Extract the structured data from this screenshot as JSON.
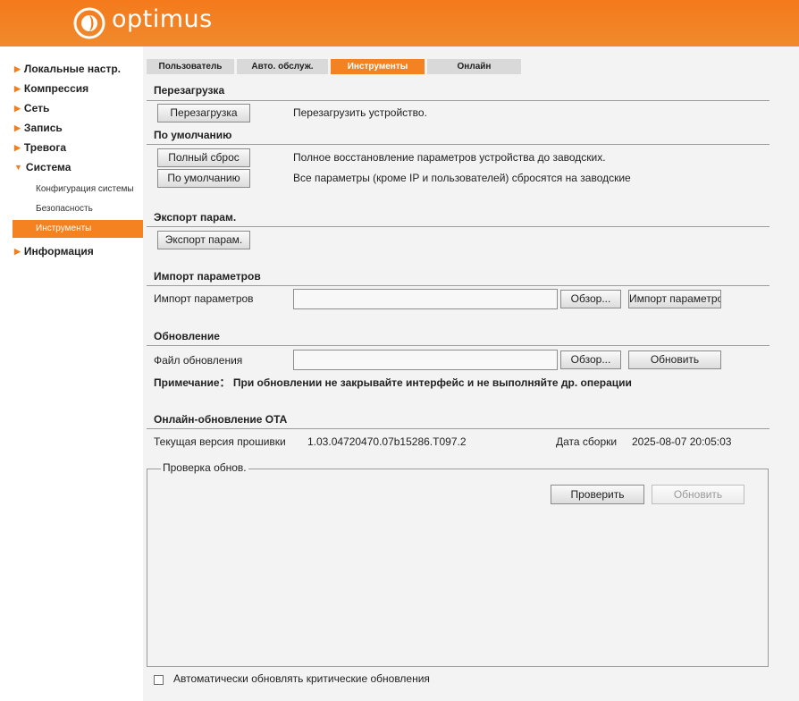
{
  "brand": {
    "name": "optimus"
  },
  "colors": {
    "accent": "#f58220",
    "topbar": "#f47a1c",
    "content_bg": "#f3f3f3"
  },
  "sidebar": {
    "items": [
      {
        "label": "Локальные настр.",
        "icon": "arrow-right"
      },
      {
        "label": "Компрессия",
        "icon": "arrow-right"
      },
      {
        "label": "Сеть",
        "icon": "arrow-right"
      },
      {
        "label": "Запись",
        "icon": "arrow-right"
      },
      {
        "label": "Тревога",
        "icon": "arrow-right"
      },
      {
        "label": "Система",
        "icon": "arrow-down",
        "children": [
          {
            "label": "Конфигурация системы"
          },
          {
            "label": "Безопасность"
          },
          {
            "label": "Инструменты",
            "active": true
          }
        ]
      },
      {
        "label": "Информация",
        "icon": "arrow-right"
      }
    ]
  },
  "tabs": [
    {
      "label": "Пользователь"
    },
    {
      "label": "Авто. обслуж."
    },
    {
      "label": "Инструменты",
      "active": true
    },
    {
      "label": "Онлайн"
    }
  ],
  "reboot": {
    "title": "Перезагрузка",
    "button": "Перезагрузка",
    "desc": "Перезагрузить устройство."
  },
  "defaults": {
    "title": "По умолчанию",
    "full_reset_button": "Полный сброс",
    "full_reset_desc": "Полное восстановление параметров устройства до заводских.",
    "default_button": "По умолчанию",
    "default_desc": "Все параметры (кроме IP и пользователей) сбросятся на заводские"
  },
  "export": {
    "title": "Экспорт парам.",
    "button": "Экспорт парам."
  },
  "import": {
    "title": "Импорт параметров",
    "label": "Импорт параметров",
    "file_value": "",
    "browse_button": "Обзор...",
    "import_button": "Импорт параметро"
  },
  "upgrade": {
    "title": "Обновление",
    "label": "Файл обновления",
    "file_value": "",
    "browse_button": "Обзор...",
    "upgrade_button": "Обновить",
    "note": "Примечание： При обновлении не закрывайте интерфейс и не выполняйте др. операции"
  },
  "ota": {
    "title": "Онлайн-обновление OTA",
    "fw_label": "Текущая версия прошивки",
    "fw_version": "1.03.04720470.07b15286.T097.2",
    "build_label": "Дата сборки",
    "build_date": "2025-08-07 20:05:03",
    "check_legend": "Проверка обнов.",
    "check_button": "Проверить",
    "update_button": "Обновить",
    "auto_update_label": "Автоматически обновлять критические обновления",
    "auto_update_checked": false
  }
}
